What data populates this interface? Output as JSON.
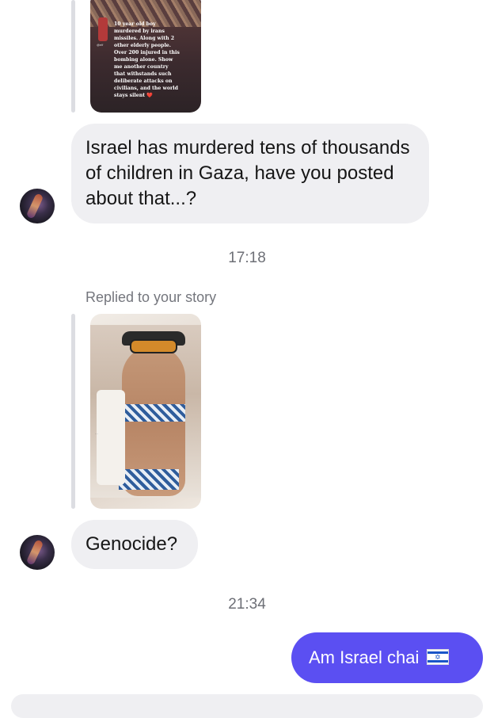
{
  "story1": {
    "caption": "10 year old boy murdered by irans missiles. Along with 2 other elderly people. Over 200 injured in this bombing alone. Show me another country that withstands such deliberate attacks on civilians, and the world stays silent ❤️"
  },
  "messages": {
    "first_reply": "Israel has murdered tens of thousands of children in Gaza, have you posted about that...?",
    "time_1": "17:18",
    "replied_label": "Replied to your story",
    "second_reply": "Genocide?",
    "time_2": "21:34",
    "sent_message": "Am Israel chai"
  },
  "colors": {
    "sent_bubble": "#5b4ff2",
    "received_bubble": "#efeff2",
    "timestamp": "#6d6f76"
  },
  "icons": {
    "flag": "israel-flag-icon"
  }
}
